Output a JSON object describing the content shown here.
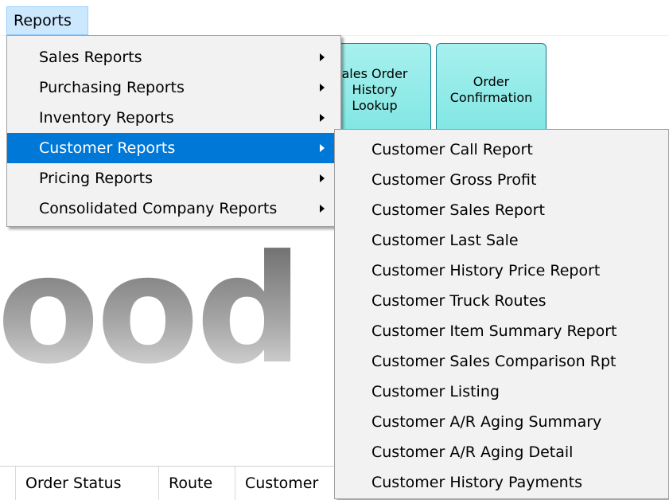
{
  "menubar": {
    "reports_label": "Reports"
  },
  "toolbar": {
    "history_label": "ales Order\nHistory\nLookup",
    "confirm_label": "Order\nConfirmation"
  },
  "logo": {
    "text": "ood"
  },
  "grid": {
    "columns": [
      "Order Status",
      "Route",
      "Customer"
    ]
  },
  "reports_menu": {
    "items": [
      {
        "label": "Sales Reports",
        "has_submenu": true
      },
      {
        "label": "Purchasing Reports",
        "has_submenu": true
      },
      {
        "label": "Inventory Reports",
        "has_submenu": true
      },
      {
        "label": "Customer Reports",
        "has_submenu": true,
        "selected": true
      },
      {
        "label": "Pricing Reports",
        "has_submenu": true
      },
      {
        "label": "Consolidated Company Reports",
        "has_submenu": true
      }
    ]
  },
  "customer_reports_menu": {
    "items": [
      "Customer Call Report",
      "Customer Gross Profit",
      "Customer Sales Report",
      "Customer Last Sale",
      "Customer History Price Report",
      "Customer Truck Routes",
      "Customer Item Summary Report",
      "Customer Sales Comparison Rpt",
      "Customer Listing",
      "Customer A/R Aging Summary",
      "Customer A/R Aging Detail",
      "Customer History Payments"
    ]
  },
  "colors": {
    "selected_bg": "#0078d7",
    "menu_bg": "#f2f2f2",
    "menubar_active": "#cce8ff",
    "toolbar_button": "#7fe6e3"
  }
}
